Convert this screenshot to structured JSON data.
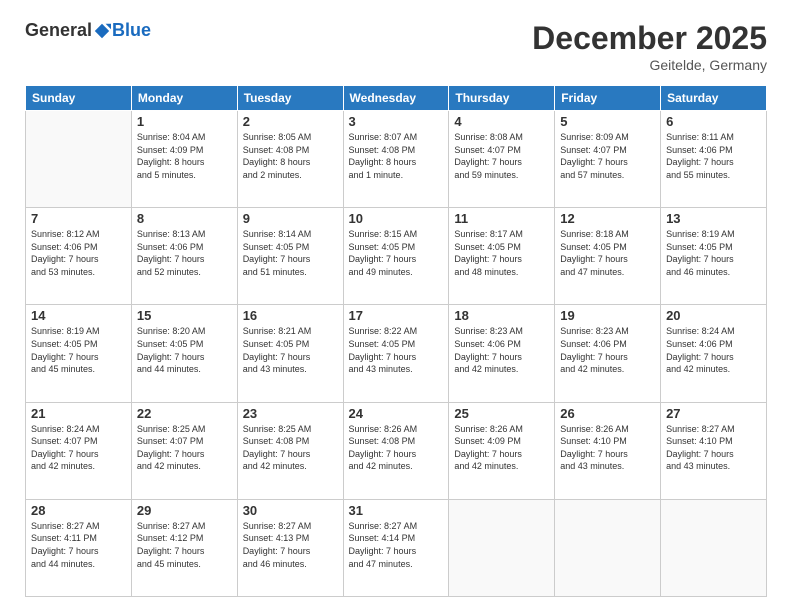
{
  "logo": {
    "general": "General",
    "blue": "Blue"
  },
  "header": {
    "month": "December 2025",
    "location": "Geitelde, Germany"
  },
  "weekdays": [
    "Sunday",
    "Monday",
    "Tuesday",
    "Wednesday",
    "Thursday",
    "Friday",
    "Saturday"
  ],
  "weeks": [
    [
      {
        "day": "",
        "info": ""
      },
      {
        "day": "1",
        "info": "Sunrise: 8:04 AM\nSunset: 4:09 PM\nDaylight: 8 hours\nand 5 minutes."
      },
      {
        "day": "2",
        "info": "Sunrise: 8:05 AM\nSunset: 4:08 PM\nDaylight: 8 hours\nand 2 minutes."
      },
      {
        "day": "3",
        "info": "Sunrise: 8:07 AM\nSunset: 4:08 PM\nDaylight: 8 hours\nand 1 minute."
      },
      {
        "day": "4",
        "info": "Sunrise: 8:08 AM\nSunset: 4:07 PM\nDaylight: 7 hours\nand 59 minutes."
      },
      {
        "day": "5",
        "info": "Sunrise: 8:09 AM\nSunset: 4:07 PM\nDaylight: 7 hours\nand 57 minutes."
      },
      {
        "day": "6",
        "info": "Sunrise: 8:11 AM\nSunset: 4:06 PM\nDaylight: 7 hours\nand 55 minutes."
      }
    ],
    [
      {
        "day": "7",
        "info": "Sunrise: 8:12 AM\nSunset: 4:06 PM\nDaylight: 7 hours\nand 53 minutes."
      },
      {
        "day": "8",
        "info": "Sunrise: 8:13 AM\nSunset: 4:06 PM\nDaylight: 7 hours\nand 52 minutes."
      },
      {
        "day": "9",
        "info": "Sunrise: 8:14 AM\nSunset: 4:05 PM\nDaylight: 7 hours\nand 51 minutes."
      },
      {
        "day": "10",
        "info": "Sunrise: 8:15 AM\nSunset: 4:05 PM\nDaylight: 7 hours\nand 49 minutes."
      },
      {
        "day": "11",
        "info": "Sunrise: 8:17 AM\nSunset: 4:05 PM\nDaylight: 7 hours\nand 48 minutes."
      },
      {
        "day": "12",
        "info": "Sunrise: 8:18 AM\nSunset: 4:05 PM\nDaylight: 7 hours\nand 47 minutes."
      },
      {
        "day": "13",
        "info": "Sunrise: 8:19 AM\nSunset: 4:05 PM\nDaylight: 7 hours\nand 46 minutes."
      }
    ],
    [
      {
        "day": "14",
        "info": "Sunrise: 8:19 AM\nSunset: 4:05 PM\nDaylight: 7 hours\nand 45 minutes."
      },
      {
        "day": "15",
        "info": "Sunrise: 8:20 AM\nSunset: 4:05 PM\nDaylight: 7 hours\nand 44 minutes."
      },
      {
        "day": "16",
        "info": "Sunrise: 8:21 AM\nSunset: 4:05 PM\nDaylight: 7 hours\nand 43 minutes."
      },
      {
        "day": "17",
        "info": "Sunrise: 8:22 AM\nSunset: 4:05 PM\nDaylight: 7 hours\nand 43 minutes."
      },
      {
        "day": "18",
        "info": "Sunrise: 8:23 AM\nSunset: 4:06 PM\nDaylight: 7 hours\nand 42 minutes."
      },
      {
        "day": "19",
        "info": "Sunrise: 8:23 AM\nSunset: 4:06 PM\nDaylight: 7 hours\nand 42 minutes."
      },
      {
        "day": "20",
        "info": "Sunrise: 8:24 AM\nSunset: 4:06 PM\nDaylight: 7 hours\nand 42 minutes."
      }
    ],
    [
      {
        "day": "21",
        "info": "Sunrise: 8:24 AM\nSunset: 4:07 PM\nDaylight: 7 hours\nand 42 minutes."
      },
      {
        "day": "22",
        "info": "Sunrise: 8:25 AM\nSunset: 4:07 PM\nDaylight: 7 hours\nand 42 minutes."
      },
      {
        "day": "23",
        "info": "Sunrise: 8:25 AM\nSunset: 4:08 PM\nDaylight: 7 hours\nand 42 minutes."
      },
      {
        "day": "24",
        "info": "Sunrise: 8:26 AM\nSunset: 4:08 PM\nDaylight: 7 hours\nand 42 minutes."
      },
      {
        "day": "25",
        "info": "Sunrise: 8:26 AM\nSunset: 4:09 PM\nDaylight: 7 hours\nand 42 minutes."
      },
      {
        "day": "26",
        "info": "Sunrise: 8:26 AM\nSunset: 4:10 PM\nDaylight: 7 hours\nand 43 minutes."
      },
      {
        "day": "27",
        "info": "Sunrise: 8:27 AM\nSunset: 4:10 PM\nDaylight: 7 hours\nand 43 minutes."
      }
    ],
    [
      {
        "day": "28",
        "info": "Sunrise: 8:27 AM\nSunset: 4:11 PM\nDaylight: 7 hours\nand 44 minutes."
      },
      {
        "day": "29",
        "info": "Sunrise: 8:27 AM\nSunset: 4:12 PM\nDaylight: 7 hours\nand 45 minutes."
      },
      {
        "day": "30",
        "info": "Sunrise: 8:27 AM\nSunset: 4:13 PM\nDaylight: 7 hours\nand 46 minutes."
      },
      {
        "day": "31",
        "info": "Sunrise: 8:27 AM\nSunset: 4:14 PM\nDaylight: 7 hours\nand 47 minutes."
      },
      {
        "day": "",
        "info": ""
      },
      {
        "day": "",
        "info": ""
      },
      {
        "day": "",
        "info": ""
      }
    ]
  ]
}
